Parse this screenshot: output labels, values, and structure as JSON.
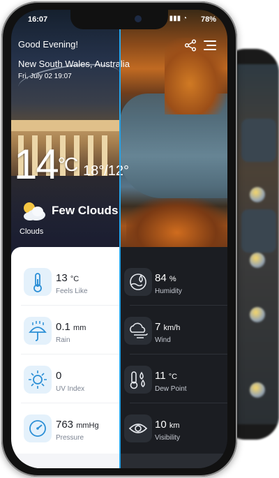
{
  "status_bar": {
    "time": "16:07",
    "battery": "78%"
  },
  "header": {
    "greeting": "Good Evening!",
    "location": "New South Wales, Australia",
    "datetime": "Fri, July 02  19:07"
  },
  "current": {
    "temperature": "14",
    "unit": "°C",
    "high_low": "18°/12°",
    "condition": "Few Clouds",
    "condition_sub": "Clouds"
  },
  "details_left": [
    {
      "icon": "thermometer-icon",
      "value": "13",
      "unit": "°C",
      "label": "Feels Like"
    },
    {
      "icon": "rain-umbrella-icon",
      "value": "0.1",
      "unit": "mm",
      "label": "Rain"
    },
    {
      "icon": "sun-icon",
      "value": "0",
      "unit": "",
      "label": "UV Index"
    },
    {
      "icon": "gauge-icon",
      "value": "763",
      "unit": "mmHg",
      "label": "Pressure"
    }
  ],
  "details_right": [
    {
      "icon": "humidity-icon",
      "value": "84",
      "unit": "%",
      "label": "Humidity"
    },
    {
      "icon": "wind-icon",
      "value": "7",
      "unit": "km/h",
      "label": "Wind"
    },
    {
      "icon": "dew-point-icon",
      "value": "11",
      "unit": "°C",
      "label": "Dew Point"
    },
    {
      "icon": "eye-icon",
      "value": "10",
      "unit": "km",
      "label": "Visibility"
    }
  ],
  "colors": {
    "accent": "#26a3e8",
    "dark_panel": "#1b1d22",
    "light_panel": "#ffffff",
    "icon_bg_light": "#e4f1fb",
    "icon_stroke": "#2b8fd6"
  }
}
